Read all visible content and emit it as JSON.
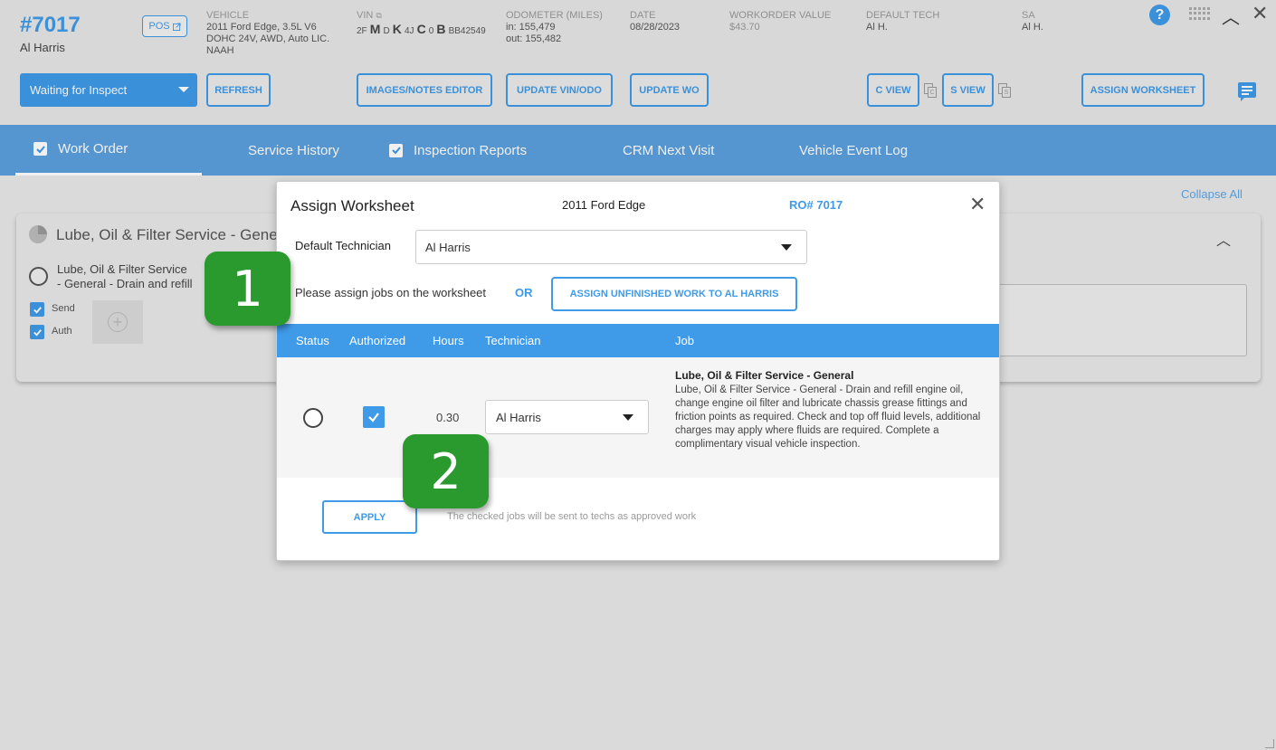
{
  "header": {
    "wo_number": "#7017",
    "customer_name": "Al Harris",
    "pos_label": "POS",
    "vehicle_label": "VEHICLE",
    "vehicle_value": "2011 Ford Edge, 3.5L V6 DOHC 24V, AWD, Auto LIC. NAAH",
    "vin_label": "VIN",
    "vin_parts": [
      "2F",
      "M",
      "D",
      "K",
      "4J",
      "C",
      "0",
      "B",
      "BB42549"
    ],
    "odometer_label": "ODOMETER (MILES)",
    "odometer_in": "in: 155,479",
    "odometer_out": "out: 155,482",
    "date_label": "DATE",
    "date_value": "08/28/2023",
    "wo_value_label": "WORKORDER VALUE",
    "wo_value": "$43.70",
    "default_tech_label": "DEFAULT TECH",
    "default_tech_value": "Al H.",
    "sa_label": "SA",
    "sa_value": "Al H.",
    "help_glyph": "?",
    "status_select_value": "Waiting for Inspect",
    "buttons": {
      "refresh": "REFRESH",
      "images_notes": "IMAGES/NOTES EDITOR",
      "update_vin": "UPDATE VIN/ODO",
      "update_wo": "UPDATE WO",
      "c_view": "C VIEW",
      "s_view": "S VIEW",
      "assign_worksheet": "ASSIGN WORKSHEET"
    }
  },
  "tabs": [
    {
      "label": "Work Order",
      "checked": true,
      "active": true
    },
    {
      "label": "Service History",
      "checked": false,
      "active": false
    },
    {
      "label": "Inspection Reports",
      "checked": true,
      "active": false
    },
    {
      "label": "CRM Next Visit",
      "checked": false,
      "active": false
    },
    {
      "label": "Vehicle Event Log",
      "checked": false,
      "active": false
    }
  ],
  "content": {
    "collapse_all": "Collapse All",
    "card_title": "Lube, Oil & Filter Service - General",
    "card_job_line1": "Lube, Oil & Filter Service",
    "card_job_line2": "- General - Drain and refill",
    "send_label": "Send",
    "auth_label": "Auth"
  },
  "modal": {
    "title": "Assign Worksheet",
    "vehicle": "2011 Ford Edge",
    "ro": "RO# 7017",
    "default_tech_label": "Default Technician",
    "default_tech_value": "Al Harris",
    "assign_text": "Please assign jobs on the worksheet",
    "or_text": "OR",
    "assign_unfinished": "ASSIGN UNFINISHED WORK TO AL HARRIS",
    "columns": [
      "Status",
      "Authorized",
      "Hours",
      "Technician",
      "Job"
    ],
    "rows": [
      {
        "hours": "0.30",
        "technician": "Al Harris",
        "authorized": true,
        "job_title": "Lube, Oil & Filter Service - General",
        "job_desc": "Lube, Oil & Filter Service - General - Drain and refill engine oil, change engine oil filter and lubricate chassis grease fittings and friction points as required. Check and top off fluid levels, additional charges may apply where fluids are required. Complete a complimentary visual vehicle inspection."
      }
    ],
    "apply": "APPLY",
    "apply_note": "The checked jobs will be sent to techs as approved work"
  },
  "callouts": [
    "1",
    "2"
  ],
  "colors": {
    "accent": "#3f9ae8",
    "tabbar": "#5b9fde",
    "callout": "#2a9a2f"
  }
}
